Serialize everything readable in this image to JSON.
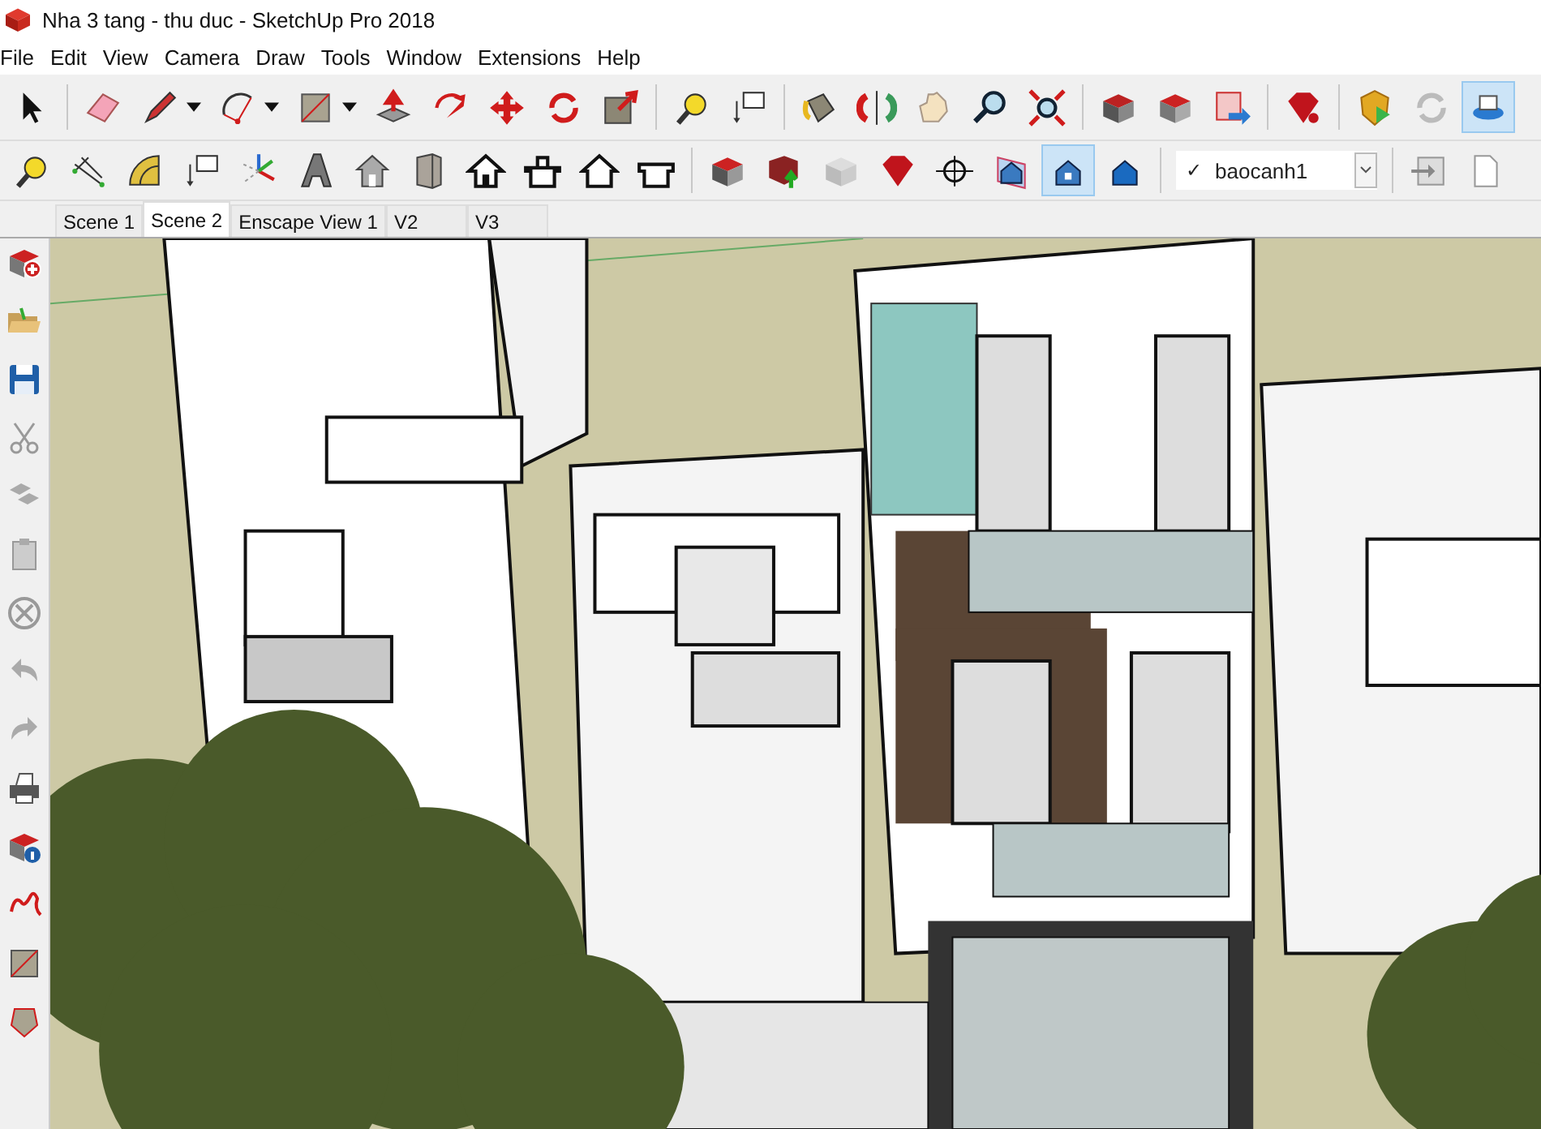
{
  "window": {
    "title": "Nha 3 tang - thu duc - SketchUp Pro 2018"
  },
  "menu": [
    "File",
    "Edit",
    "View",
    "Camera",
    "Draw",
    "Tools",
    "Window",
    "Extensions",
    "Help"
  ],
  "toolbar_1": [
    {
      "selected": false
    },
    {
      "selected": false
    },
    {
      "selected": false
    },
    {
      "selected": false
    },
    {
      "selected": false
    },
    {
      "selected": false
    },
    {
      "selected": false
    },
    {
      "selected": false
    },
    {
      "selected": false
    },
    {
      "selected": false
    },
    {
      "selected": false
    },
    {
      "selected": false
    },
    {
      "selected": false
    },
    {
      "selected": false
    },
    {
      "selected": false
    },
    {
      "selected": false
    },
    {
      "selected": false
    },
    {
      "selected": false
    },
    {
      "selected": false
    },
    {
      "selected": false
    },
    {
      "selected": false
    },
    {
      "selected": false
    },
    {
      "selected": false
    },
    {
      "selected": true
    }
  ],
  "toolbar_2": [
    {
      "selected": false
    },
    {
      "selected": false
    },
    {
      "selected": false
    },
    {
      "selected": false
    },
    {
      "selected": false
    },
    {
      "selected": false
    },
    {
      "selected": false
    },
    {
      "selected": false
    },
    {
      "selected": false
    },
    {
      "selected": false
    },
    {
      "selected": false
    },
    {
      "selected": false
    },
    {
      "selected": false
    },
    {
      "selected": false
    },
    {
      "selected": false
    },
    {
      "selected": false
    },
    {
      "selected": false
    },
    {
      "selected": false
    },
    {
      "selected": true
    },
    {
      "selected": false
    },
    {
      "selected": false
    },
    {
      "selected": false
    }
  ],
  "style_dropdown": {
    "check": "✓",
    "value": "baocanh1"
  },
  "scene_tabs": [
    {
      "label": "Scene 1",
      "selected": false
    },
    {
      "label": "Scene 2",
      "selected": true
    },
    {
      "label": "Enscape View 1",
      "selected": false
    },
    {
      "label": "V2",
      "selected": false
    },
    {
      "label": "V3",
      "selected": false
    }
  ]
}
